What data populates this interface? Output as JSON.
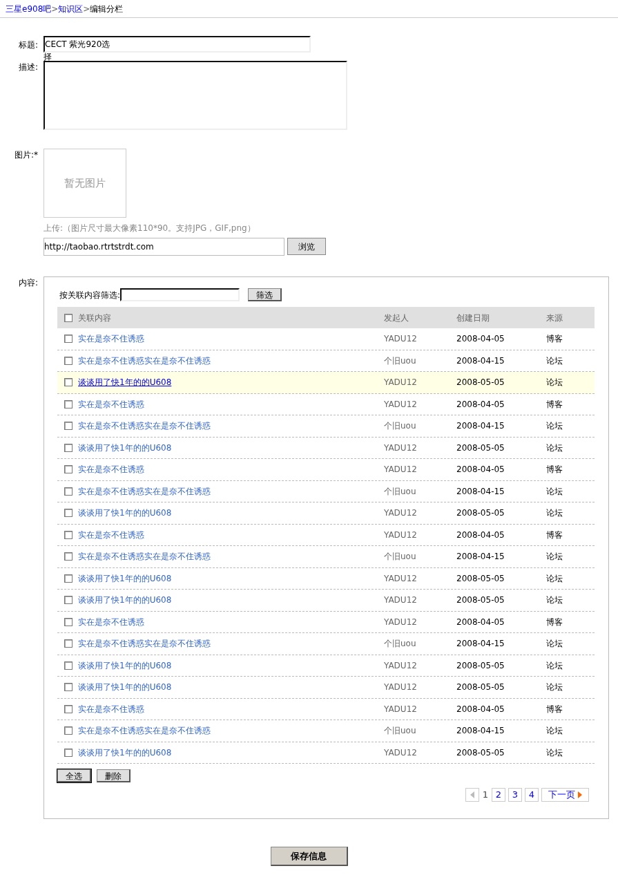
{
  "breadcrumb": [
    {
      "label": "三星e908吧",
      "kind": "link"
    },
    {
      "label": ">",
      "kind": "sep"
    },
    {
      "label": "知识区",
      "kind": "link"
    },
    {
      "label": ">",
      "kind": "sep"
    },
    {
      "label": "编辑分栏",
      "kind": "current"
    }
  ],
  "form": {
    "title_label": "标题:",
    "title_value": "CECT 紫光920选",
    "title_overflow": "择",
    "description_label": "描述:",
    "image_label": "图片:*",
    "image_placeholder": "暂无图片",
    "upload_hint": "上传:（图片尺寸最大像素110*90。支持JPG，GIF,png）",
    "upload_value": "http://taobao.rtrtstrdt.com",
    "browse_button": "浏览",
    "content_label": "内容:"
  },
  "filter": {
    "label": "按关联内容筛选:",
    "button": "筛选"
  },
  "table": {
    "columns": [
      "关联内容",
      "发起人",
      "创建日期",
      "来源"
    ],
    "select_all_checked": false,
    "rows": [
      {
        "title": "实在是奈不住诱惑",
        "author": "YADU12",
        "date": "2008-04-05",
        "source": "博客",
        "checked": false,
        "highlighted": false
      },
      {
        "title": "实在是奈不住诱惑实在是奈不住诱惑",
        "author": "个旧uou",
        "date": "2008-04-15",
        "source": "论坛",
        "checked": false,
        "highlighted": false
      },
      {
        "title": "谈谈用了快1年的的U608",
        "author": "YADU12",
        "date": "2008-05-05",
        "source": "论坛",
        "checked": false,
        "highlighted": true
      },
      {
        "title": "实在是奈不住诱惑",
        "author": "YADU12",
        "date": "2008-04-05",
        "source": "博客",
        "checked": false,
        "highlighted": false
      },
      {
        "title": "实在是奈不住诱惑实在是奈不住诱惑",
        "author": "个旧uou",
        "date": "2008-04-15",
        "source": "论坛",
        "checked": false,
        "highlighted": false
      },
      {
        "title": "谈谈用了快1年的的U608",
        "author": "YADU12",
        "date": "2008-05-05",
        "source": "论坛",
        "checked": false,
        "highlighted": false
      },
      {
        "title": "实在是奈不住诱惑",
        "author": "YADU12",
        "date": "2008-04-05",
        "source": "博客",
        "checked": false,
        "highlighted": false
      },
      {
        "title": "实在是奈不住诱惑实在是奈不住诱惑",
        "author": "个旧uou",
        "date": "2008-04-15",
        "source": "论坛",
        "checked": false,
        "highlighted": false
      },
      {
        "title": "谈谈用了快1年的的U608",
        "author": "YADU12",
        "date": "2008-05-05",
        "source": "论坛",
        "checked": false,
        "highlighted": false
      },
      {
        "title": "实在是奈不住诱惑",
        "author": "YADU12",
        "date": "2008-04-05",
        "source": "博客",
        "checked": false,
        "highlighted": false
      },
      {
        "title": "实在是奈不住诱惑实在是奈不住诱惑",
        "author": "个旧uou",
        "date": "2008-04-15",
        "source": "论坛",
        "checked": false,
        "highlighted": false
      },
      {
        "title": "谈谈用了快1年的的U608",
        "author": "YADU12",
        "date": "2008-05-05",
        "source": "论坛",
        "checked": false,
        "highlighted": false
      },
      {
        "title": "谈谈用了快1年的的U608",
        "author": "YADU12",
        "date": "2008-05-05",
        "source": "论坛",
        "checked": false,
        "highlighted": false
      },
      {
        "title": "实在是奈不住诱惑",
        "author": "YADU12",
        "date": "2008-04-05",
        "source": "博客",
        "checked": false,
        "highlighted": false
      },
      {
        "title": "实在是奈不住诱惑实在是奈不住诱惑",
        "author": "个旧uou",
        "date": "2008-04-15",
        "source": "论坛",
        "checked": false,
        "highlighted": false
      },
      {
        "title": "谈谈用了快1年的的U608",
        "author": "YADU12",
        "date": "2008-05-05",
        "source": "论坛",
        "checked": false,
        "highlighted": false
      },
      {
        "title": "谈谈用了快1年的的U608",
        "author": "YADU12",
        "date": "2008-05-05",
        "source": "论坛",
        "checked": false,
        "highlighted": false
      },
      {
        "title": "实在是奈不住诱惑",
        "author": "YADU12",
        "date": "2008-04-05",
        "source": "博客",
        "checked": false,
        "highlighted": false
      },
      {
        "title": "实在是奈不住诱惑实在是奈不住诱惑",
        "author": "个旧uou",
        "date": "2008-04-15",
        "source": "论坛",
        "checked": false,
        "highlighted": false
      },
      {
        "title": "谈谈用了快1年的的U608",
        "author": "YADU12",
        "date": "2008-05-05",
        "source": "论坛",
        "checked": false,
        "highlighted": false
      }
    ]
  },
  "list_buttons": [
    "全选",
    "删除"
  ],
  "pagination": {
    "prev_disabled": true,
    "pages": [
      {
        "label": "1",
        "selected": true
      },
      {
        "label": "2",
        "selected": false
      },
      {
        "label": "3",
        "selected": false
      },
      {
        "label": "4",
        "selected": false
      }
    ],
    "next": "下一页"
  },
  "save_button": "保存信息"
}
